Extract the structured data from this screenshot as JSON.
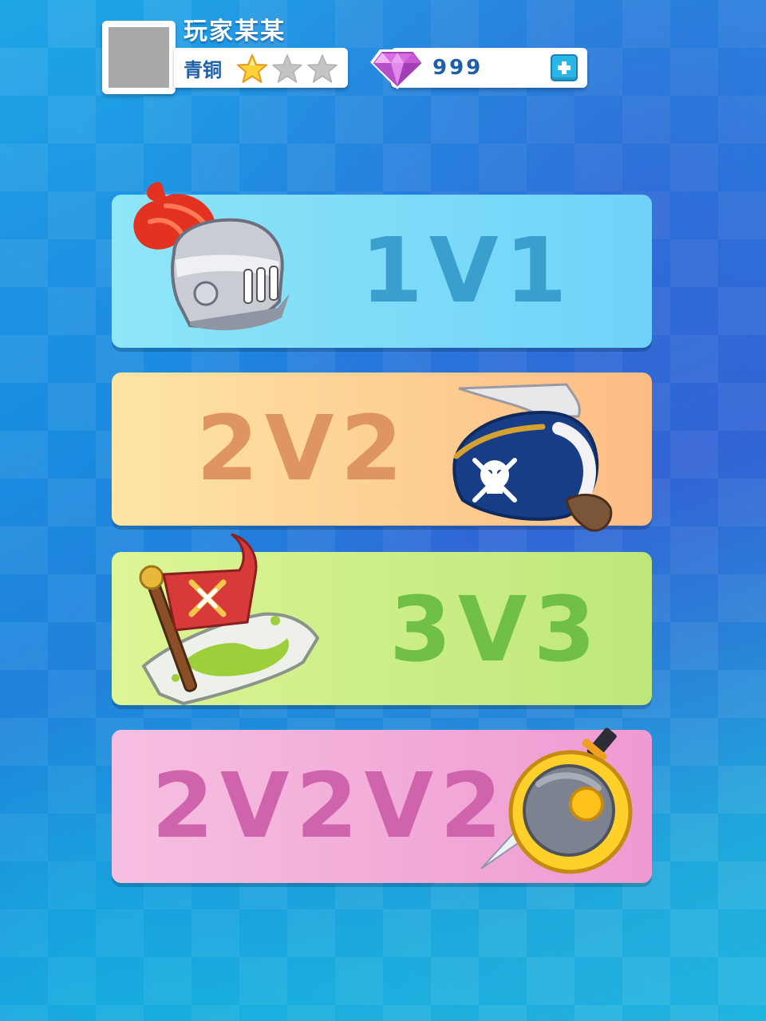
{
  "player": {
    "name": "玩家某某",
    "rank": "青铜",
    "stars_filled": 1,
    "stars_total": 3
  },
  "currency": {
    "gems": "999",
    "icon": "gem-icon"
  },
  "modes": [
    {
      "label": "1V1",
      "icon": "knight-helmet-icon"
    },
    {
      "label": "2V2",
      "icon": "pirate-hat-icon"
    },
    {
      "label": "3V3",
      "icon": "flag-map-icon"
    },
    {
      "label": "2V2V2",
      "icon": "sword-shield-icon"
    }
  ],
  "colors": {
    "mode_1": "#6fd2f8",
    "mode_2": "#fdbc84",
    "mode_3": "#bde77a",
    "mode_4": "#ef9ad2",
    "text_blue": "#1d5fa8"
  }
}
